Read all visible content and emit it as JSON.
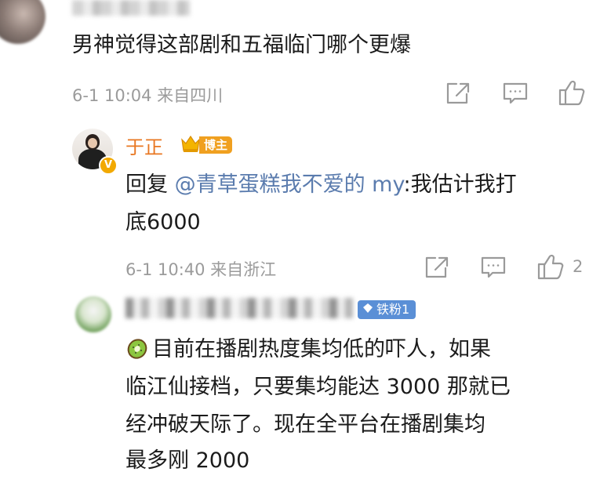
{
  "comment": {
    "text": "男神觉得这部剧和五福临门哪个更爆",
    "meta": "6-1 10:04  来自四川"
  },
  "reply1": {
    "username": "于正",
    "badge": "博主",
    "reply_prefix": "回复 ",
    "mention": "@青草蛋糕我不爱的 my",
    "text_line1_rest": ":我估计我打",
    "text_line2": "底6000",
    "meta": "6-1 10:40  来自浙江",
    "like_count": "2"
  },
  "reply2": {
    "fan_badge": "铁粉1",
    "lines": [
      "目前在播剧热度集均低的吓人，如果",
      "临江仙接档，只要集均能达 3000 那就已",
      "经冲破天际了。现在全平台在播剧集均",
      "最多刚 2000"
    ]
  },
  "icons": {
    "share": "share-icon",
    "comment": "comment-icon",
    "like": "thumbs-up-icon",
    "crown": "crown-icon",
    "verified": "verified-v-icon",
    "diamond": "diamond-icon",
    "kiwi": "kiwi-emoji-icon"
  },
  "colors": {
    "username": "#e87722",
    "mention": "#5b7cae",
    "meta": "#9b9b9b",
    "fan_badge": "#5a8fd6",
    "blogger_badge": "#f0a020"
  }
}
